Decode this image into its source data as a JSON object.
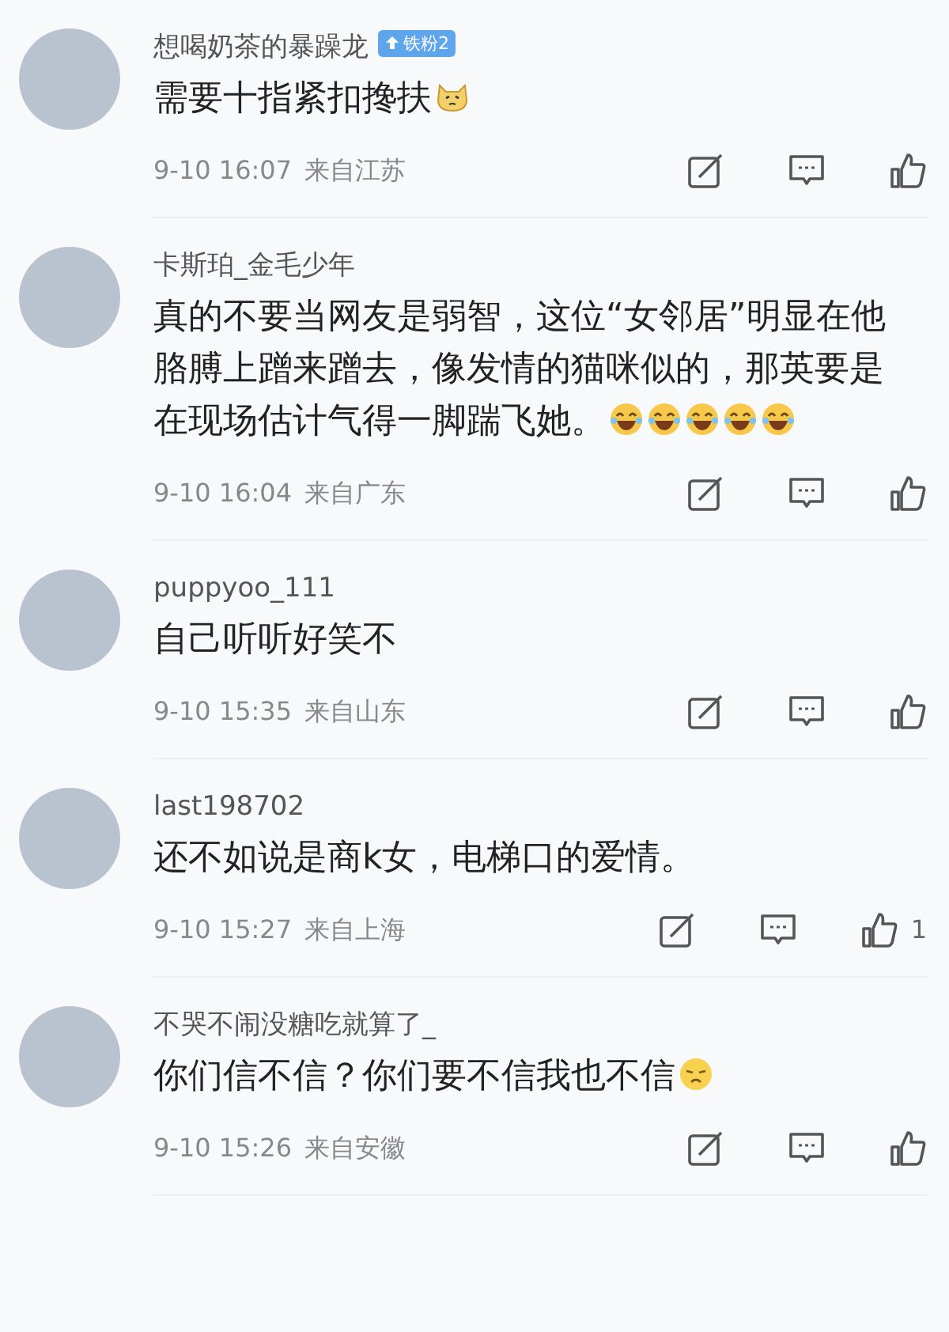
{
  "comments": [
    {
      "username": "想喝奶茶的暴躁龙",
      "badge": {
        "label": "铁粉2"
      },
      "text": "需要十指紧扣搀扶",
      "emojis": [
        {
          "kind": "cat"
        }
      ],
      "time": "9-10 16:07",
      "location": "来自江苏"
    },
    {
      "username": "卡斯珀_金毛少年",
      "text": "真的不要当网友是弱智，这位“女邻居”明显在他胳膊上蹭来蹭去，像发情的猫咪似的，那英要是在现场估计气得一脚踹飞她。",
      "emojis": [
        {
          "kind": "laugh"
        },
        {
          "kind": "laugh"
        },
        {
          "kind": "laugh"
        },
        {
          "kind": "laugh"
        },
        {
          "kind": "laugh"
        }
      ],
      "time": "9-10 16:04",
      "location": "来自广东"
    },
    {
      "username": "puppyoo_111",
      "text": "自己听听好笑不",
      "time": "9-10 15:35",
      "location": "来自山东"
    },
    {
      "username": "last198702",
      "text": "还不如说是商k女，电梯口的爱情。",
      "time": "9-10 15:27",
      "location": "来自上海",
      "like_count": "1"
    },
    {
      "username": "不哭不闹没糖吃就算了_",
      "text": "你们信不信？你们要不信我也不信",
      "emojis": [
        {
          "kind": "tired"
        }
      ],
      "time": "9-10 15:26",
      "location": "来自安徽"
    }
  ]
}
